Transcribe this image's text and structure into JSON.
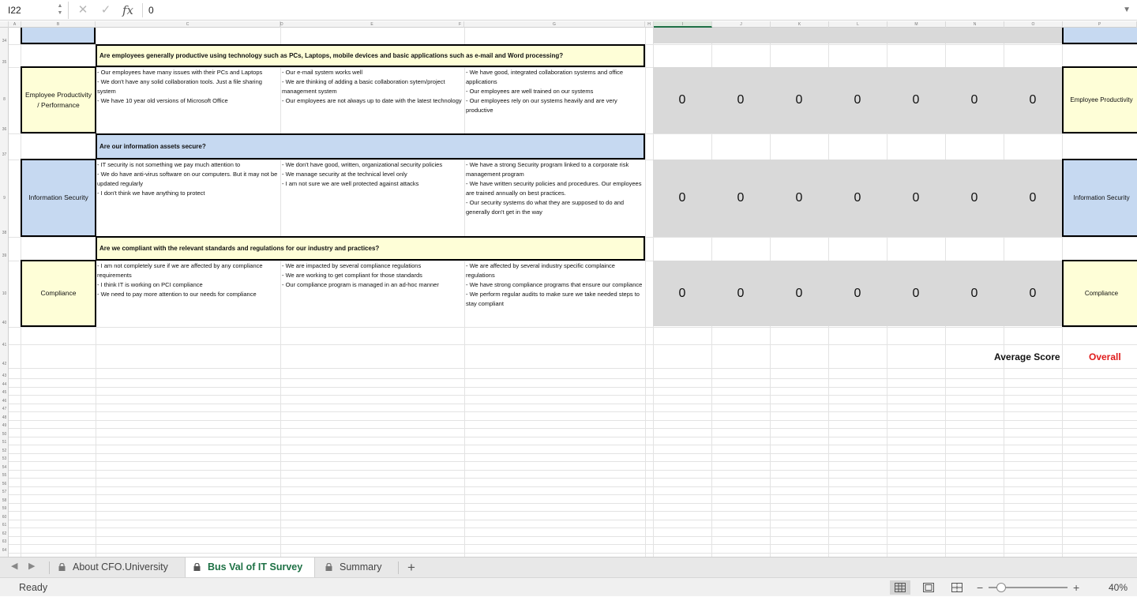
{
  "formula_bar": {
    "cell_reference": "I22",
    "cancel_icon": "✕",
    "enter_icon": "✓",
    "fx_label": "fx",
    "value": "0",
    "expand_icon": "▼"
  },
  "columns": [
    "A",
    "B",
    "C",
    "D",
    "E",
    "F",
    "G",
    "H",
    "I",
    "J",
    "K",
    "L",
    "M",
    "N",
    "O",
    "P"
  ],
  "row_numbers": {
    "r34": "34",
    "r35": "35",
    "r8": "8",
    "r36": "36",
    "r37": "37",
    "r9": "9",
    "r38": "38",
    "r39": "39",
    "r10": "10",
    "r40": "40",
    "r41": "41",
    "r42": "42",
    "rest": [
      "43",
      "44",
      "45",
      "46",
      "47",
      "48",
      "49",
      "50",
      "51",
      "52",
      "53",
      "54",
      "55",
      "56",
      "57",
      "58",
      "59",
      "60",
      "61",
      "62",
      "63",
      "64"
    ]
  },
  "sections": [
    {
      "question": "Are employees generally productive using technology such as PCs, Laptops, mobile devices and basic applications such as e-mail and Word processing?",
      "category": "Employee Productivity / Performance",
      "right_category": "Employee Productivity",
      "low": "- Our employees have many issues with their PCs and Laptops\n- We don't have any solid collaboration tools. Just a file sharing system\n- We have 10 year old versions of Microsoft Office",
      "mid": "- Our e-mail system works well\n- We are thinking of adding a basic collaboration sytem/project management system\n- Our employees are not always up to date with the latest technology",
      "high": "- We have good, integrated collaboration systems and office applications\n- Our employees are well trained on our systems\n- Our employees rely on our systems heavily and are very productive",
      "scores": [
        "0",
        "0",
        "0",
        "0",
        "0",
        "0",
        "0"
      ]
    },
    {
      "question": "Are our information assets secure?",
      "category": "Information Security",
      "right_category": "Information Security",
      "low": "- IT security is not something we pay much attention to\n- We do have anti-virus software on our computers. But it may not be updated regularly\n- I don't think we have anything to protect",
      "mid": "- We don't have good, written, organizational security policies\n- We manage security at the technical level only\n- I am not sure we are well protected against attacks",
      "high": "- We have a strong Security program linked to a corporate risk management program\n- We have written security policies and procedures. Our employees are trained annually on best practices.\n- Our security systems do what they are supposed to do and generally don't get in the way",
      "scores": [
        "0",
        "0",
        "0",
        "0",
        "0",
        "0",
        "0"
      ]
    },
    {
      "question": "Are we compliant with the relevant standards and regulations for our industry and practices?",
      "category": "Compliance",
      "right_category": "Compliance",
      "low": "- I am not completely sure if we are affected by any compliance requirements\n- I think IT is working on PCI compliance\n- We need to pay more attention to our needs for compliance",
      "mid": "- We are impacted by several compliance regulations\n- We are working to get compliant for those standards\n- Our compliance program is managed in an ad-hoc manner",
      "high": "- We are affected by several industry specific complaince regulations\n- We have strong compliance programs that ensure our compliance\n- We perform regular audits to make sure we take needed steps to stay compliant",
      "scores": [
        "0",
        "0",
        "0",
        "0",
        "0",
        "0",
        "0"
      ]
    }
  ],
  "summary": {
    "average_label": "Average Score",
    "overall_label": "Overall"
  },
  "tabs": [
    {
      "label": "About CFO.University",
      "active": false
    },
    {
      "label": "Bus Val of IT Survey",
      "active": true
    },
    {
      "label": "Summary",
      "active": false
    }
  ],
  "tab_add": "+",
  "tab_nav": {
    "prev": "◀",
    "next": "▶"
  },
  "status": {
    "text": "Ready",
    "zoom_minus": "−",
    "zoom_plus": "+",
    "zoom": "40%",
    "zoom_level_percent": 40
  },
  "colors": {
    "yellow": "#fefed7",
    "blue": "#c6d9f1",
    "gray": "#d9d9d9",
    "overall_red": "#e01b1b",
    "excel_green": "#1e7145"
  }
}
